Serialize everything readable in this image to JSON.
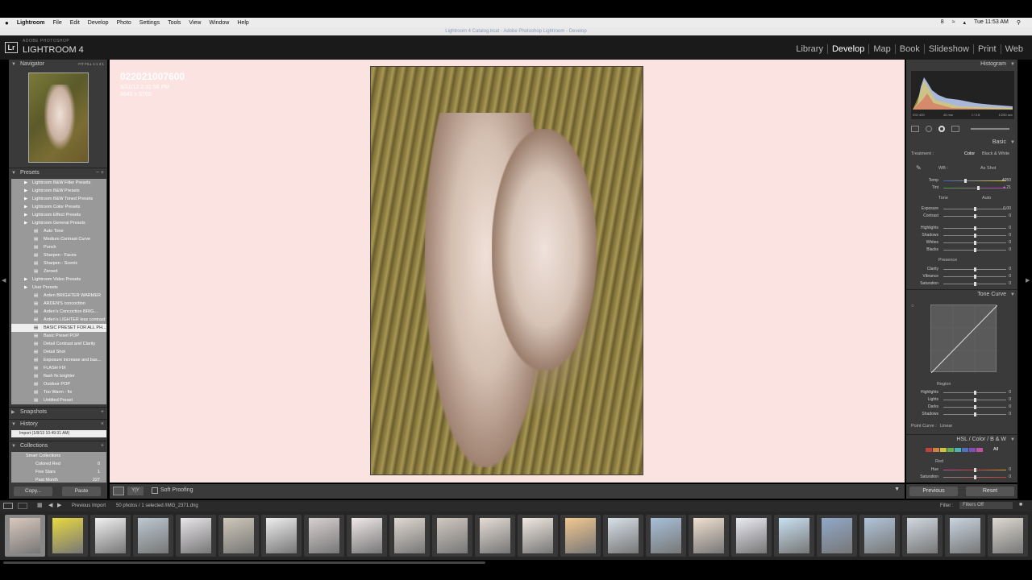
{
  "menubar": {
    "apple": "",
    "items": [
      "Lightroom",
      "File",
      "Edit",
      "Develop",
      "Photo",
      "Settings",
      "Tools",
      "View",
      "Window",
      "Help"
    ],
    "right": [
      "8",
      "Tue 11:53 AM"
    ]
  },
  "window_title": "Lightroom 4 Catalog.lrcat - Adobe Photoshop Lightroom - Develop",
  "header": {
    "logo": "Lr",
    "subtitle": "ADOBE PHOTOSHOP",
    "product": "LIGHTROOM 4",
    "modules": [
      "Library",
      "Develop",
      "Map",
      "Book",
      "Slideshow",
      "Print",
      "Web"
    ],
    "active_module": "Develop"
  },
  "left": {
    "navigator": {
      "title": "Navigator",
      "zoom_opts": [
        "FIT",
        "FILL",
        "1:1",
        "3:1"
      ]
    },
    "presets": {
      "title": "Presets",
      "items": [
        {
          "label": "Lightroom B&W Filter Presets",
          "kind": "folder"
        },
        {
          "label": "Lightroom B&W Presets",
          "kind": "folder"
        },
        {
          "label": "Lightroom B&W Toned Presets",
          "kind": "folder"
        },
        {
          "label": "Lightroom Color Presets",
          "kind": "folder"
        },
        {
          "label": "Lightroom Effect Presets",
          "kind": "folder"
        },
        {
          "label": "Lightroom General Presets",
          "kind": "folder"
        },
        {
          "label": "Auto Tone",
          "kind": "item"
        },
        {
          "label": "Medium Contrast Curve",
          "kind": "item"
        },
        {
          "label": "Punch",
          "kind": "item"
        },
        {
          "label": "Sharpen - Faces",
          "kind": "item"
        },
        {
          "label": "Sharpen - Scenic",
          "kind": "item"
        },
        {
          "label": "Zeroed",
          "kind": "item"
        },
        {
          "label": "Lightroom Video Presets",
          "kind": "folder"
        },
        {
          "label": "User Presets",
          "kind": "folder"
        },
        {
          "label": "Arden BRIGHTER WARMER",
          "kind": "item"
        },
        {
          "label": "ARDEN'S concoction",
          "kind": "item"
        },
        {
          "label": "Arden's Concoction BRIG...",
          "kind": "item"
        },
        {
          "label": "Arden's LIGHTER less contrast",
          "kind": "item"
        },
        {
          "label": "BASIC PRESET FOR ALL PH...",
          "kind": "item",
          "selected": true
        },
        {
          "label": "Basic Preset POP",
          "kind": "item"
        },
        {
          "label": "Detail Contrast and Clarity",
          "kind": "item"
        },
        {
          "label": "Detail Shot",
          "kind": "item"
        },
        {
          "label": "Exposure increase and bas...",
          "kind": "item"
        },
        {
          "label": "FLASH FIX",
          "kind": "item"
        },
        {
          "label": "flash fix brighter",
          "kind": "item"
        },
        {
          "label": "Outdoor POP",
          "kind": "item"
        },
        {
          "label": "Too Warm - fix",
          "kind": "item"
        },
        {
          "label": "Untitled Preset",
          "kind": "item"
        }
      ]
    },
    "snapshots": {
      "title": "Snapshots"
    },
    "history": {
      "title": "History",
      "entry": "Import (1/8/13 10:49:31 AM)"
    },
    "collections": {
      "title": "Collections",
      "items": [
        {
          "label": "Smart Collections",
          "count": ""
        },
        {
          "label": "Colored Red",
          "count": "0"
        },
        {
          "label": "Five Stars",
          "count": "1"
        },
        {
          "label": "Past Month",
          "count": "227"
        }
      ]
    },
    "copy": "Copy...",
    "paste": "Paste"
  },
  "image": {
    "name": "022021007600",
    "date": "3/31/12 2:31:56 PM",
    "dims": "3840 x 5760"
  },
  "center_toolbar": {
    "soft_proofing": "Soft Proofing"
  },
  "right": {
    "histogram": {
      "title": "Histogram",
      "meta": [
        "ISO 400",
        "45 mm",
        "f / 2.8",
        "1/250 sec"
      ]
    },
    "basic": {
      "title": "Basic",
      "treatment": "Treatment :",
      "color": "Color",
      "bw": "Black & White",
      "wb": "WB :",
      "wb_value": "As Shot",
      "tone": "Tone",
      "auto": "Auto",
      "presence": "Presence",
      "sliders": [
        {
          "label": "Temp",
          "value": "4050",
          "pos": 0.35
        },
        {
          "label": "Tint",
          "value": "+ 21",
          "pos": 0.55
        },
        {
          "label": "Exposure",
          "value": "0.00",
          "pos": 0.5
        },
        {
          "label": "Contrast",
          "value": "0",
          "pos": 0.5
        },
        {
          "label": "Highlights",
          "value": "0",
          "pos": 0.5
        },
        {
          "label": "Shadows",
          "value": "0",
          "pos": 0.5
        },
        {
          "label": "Whites",
          "value": "0",
          "pos": 0.5
        },
        {
          "label": "Blacks",
          "value": "0",
          "pos": 0.5
        },
        {
          "label": "Clarity",
          "value": "0",
          "pos": 0.5
        },
        {
          "label": "Vibrance",
          "value": "0",
          "pos": 0.5
        },
        {
          "label": "Saturation",
          "value": "0",
          "pos": 0.5
        }
      ]
    },
    "tone_curve": {
      "title": "Tone Curve",
      "region": "Region",
      "point_curve": "Point Curve :",
      "linear": "Linear",
      "sliders": [
        {
          "label": "Highlights",
          "value": "0"
        },
        {
          "label": "Lights",
          "value": "0"
        },
        {
          "label": "Darks",
          "value": "0"
        },
        {
          "label": "Shadows",
          "value": "0"
        }
      ]
    },
    "hsl": {
      "title": "HSL / Color / B & W",
      "all": "All",
      "red": "Red",
      "hue": "Hue",
      "sat": "Saturation",
      "hue_val": "0",
      "sat_val": "0"
    },
    "previous": "Previous",
    "reset": "Reset"
  },
  "filmstrip_bar": {
    "source": "Previous Import",
    "count": "50 photos / 1 selected /IMG_2371.dng",
    "filter_label": "Filter :",
    "filter_value": "Filters Off"
  },
  "thumb_colors": [
    "#d8c8bc",
    "#e8d840",
    "#f0f0f0",
    "#bcc8d0",
    "#e8e4e8",
    "#cfc7b8",
    "#eee",
    "#d8d0d0",
    "#f0e8e8",
    "#e0d8d0",
    "#d0c8c0",
    "#e4dcd4",
    "#f0e8e0",
    "#f2c890",
    "#d8e0e8",
    "#a8c0d8",
    "#f0e0d0",
    "#eaeaf2",
    "#c8e0f0",
    "#90a8c8",
    "#b0c4d8",
    "#d0d8e0",
    "#c8d4e0",
    "#ddd8d0"
  ]
}
